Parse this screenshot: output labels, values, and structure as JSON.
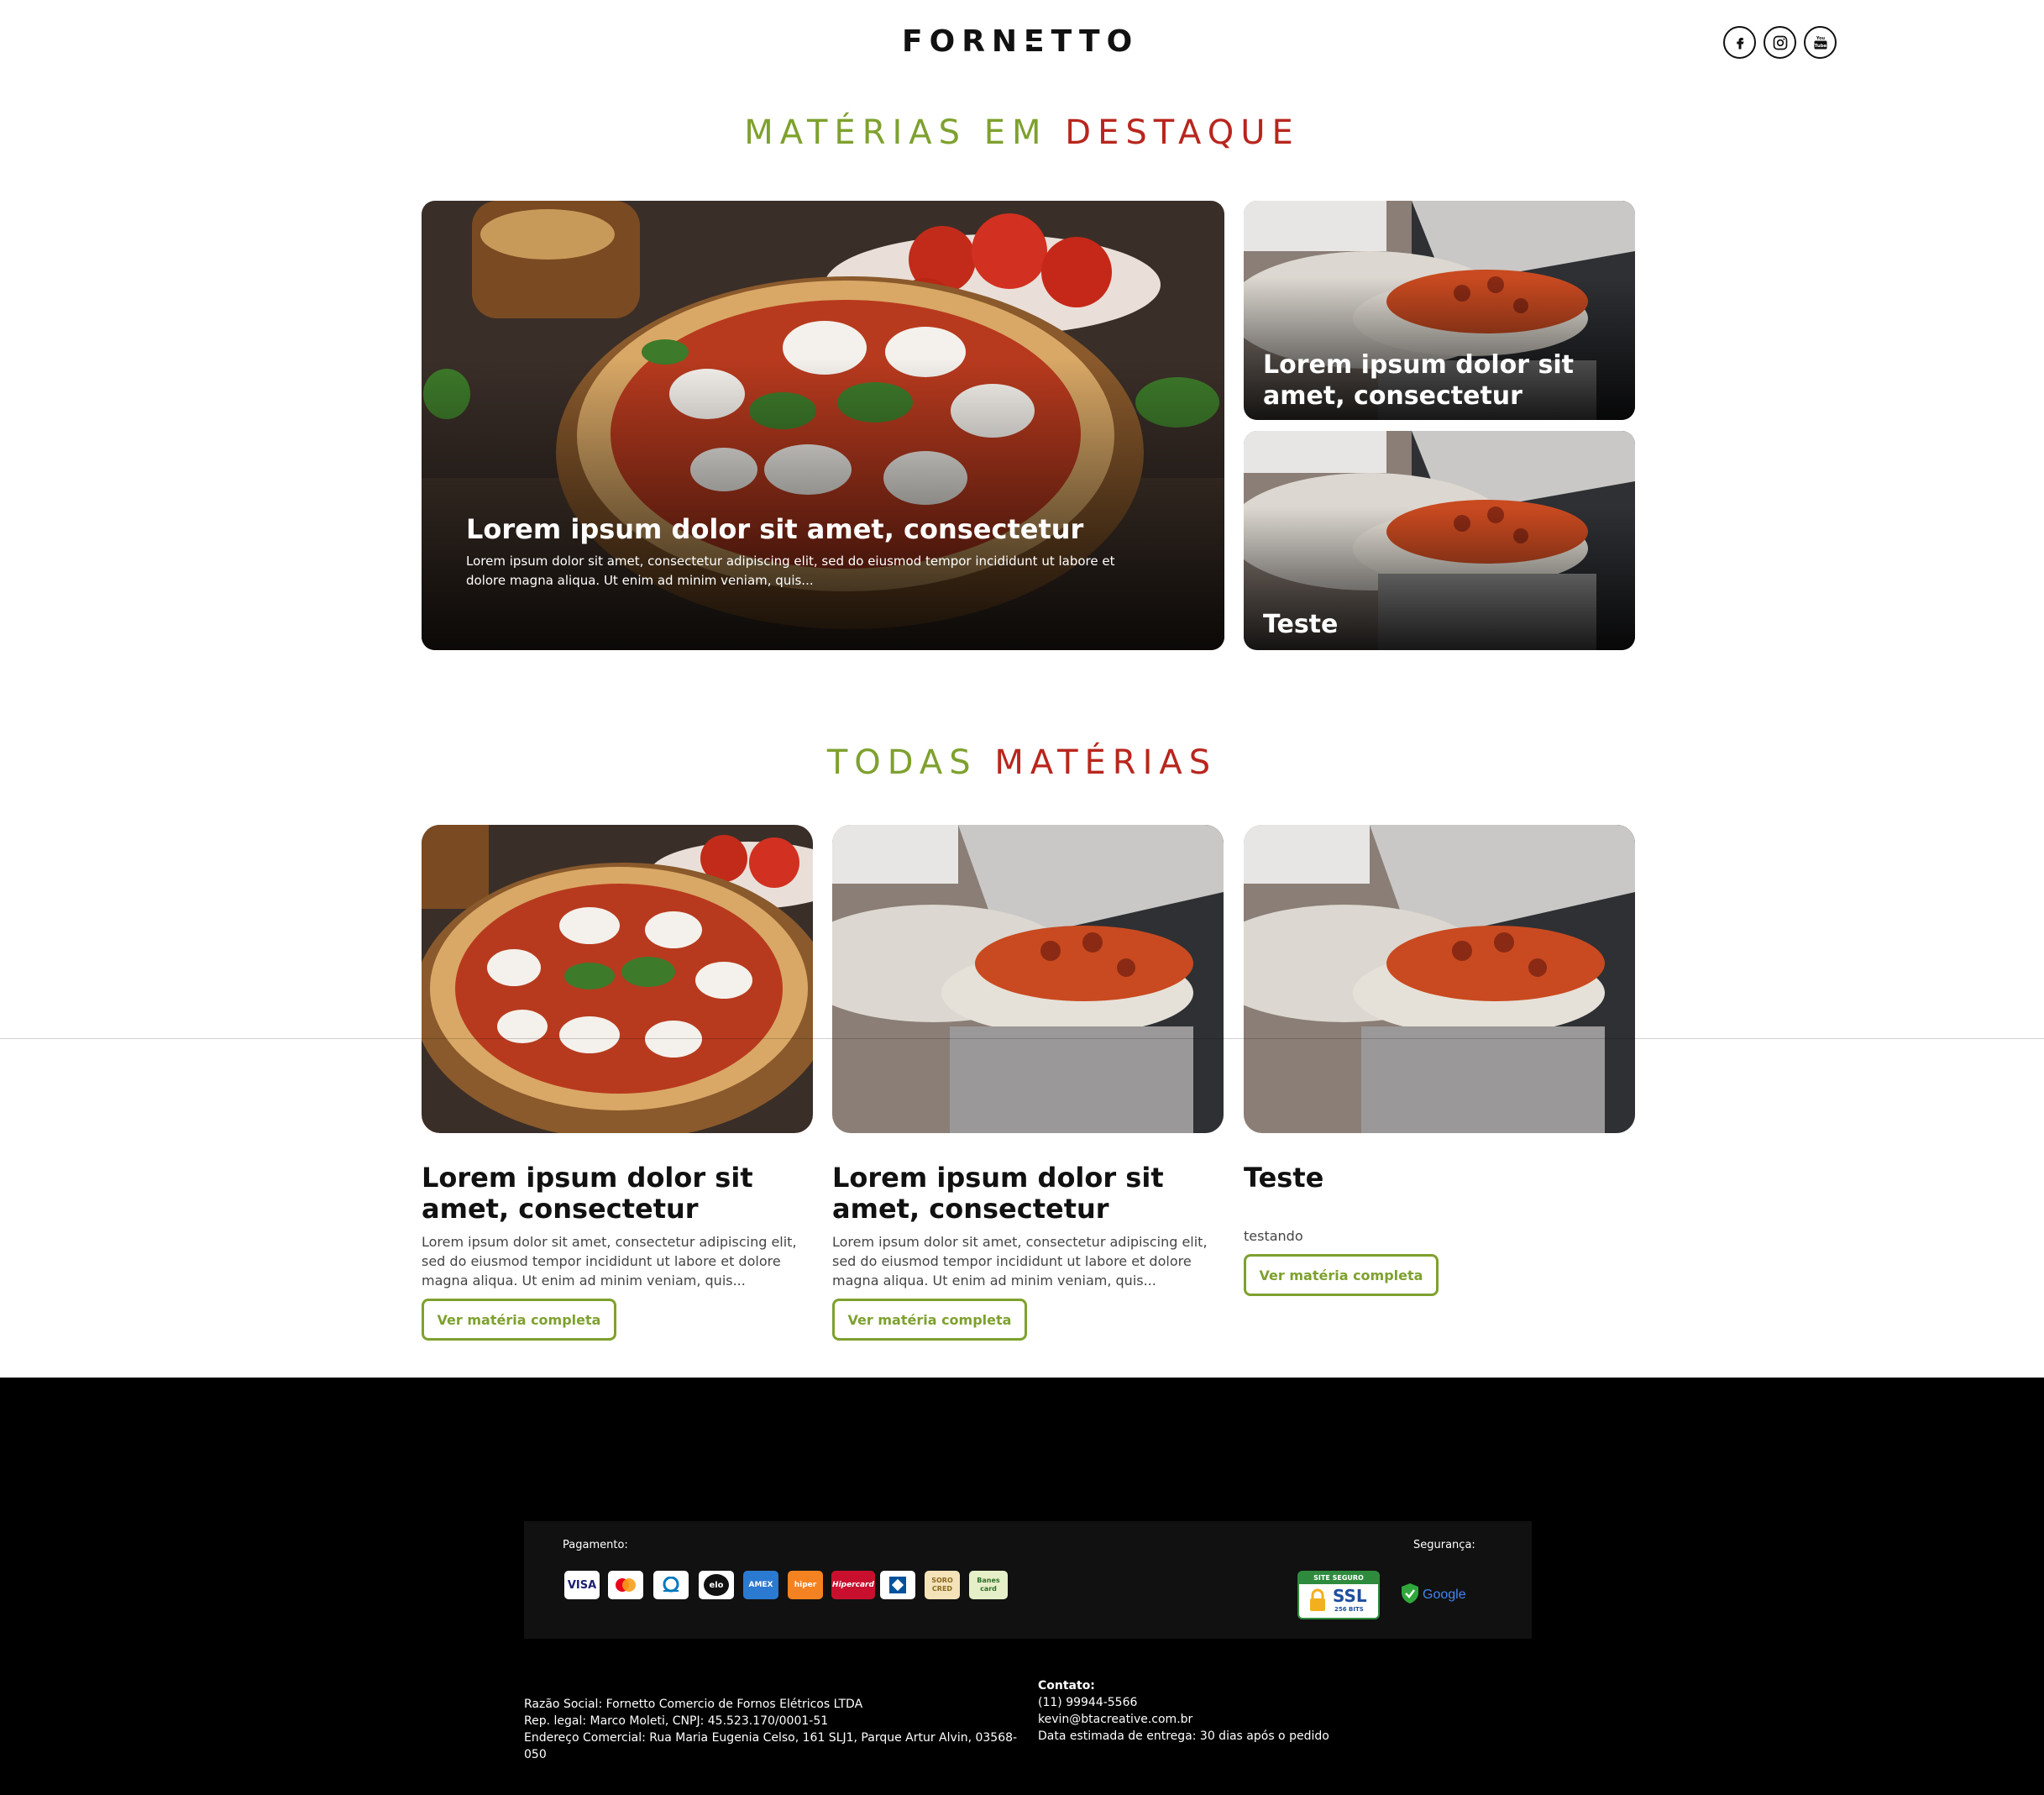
{
  "header": {
    "logo": "FORNETTO",
    "social": [
      "facebook-icon",
      "instagram-icon",
      "youtube-icon"
    ]
  },
  "featured": {
    "title_a": "MATÉRIAS EM",
    "title_b": "DESTAQUE",
    "main": {
      "title": "Lorem ipsum dolor sit amet, consectetur",
      "desc": "Lorem ipsum dolor sit amet, consectetur adipiscing elit, sed do eiusmod tempor incididunt ut labore et dolore magna aliqua. Ut enim ad minim veniam, quis..."
    },
    "side1": {
      "title": "Lorem ipsum dolor sit amet, consectetur"
    },
    "side2": {
      "title": "Teste"
    }
  },
  "all": {
    "title_a": "TODAS",
    "title_b": "MATÉRIAS",
    "articles": [
      {
        "title": "Lorem ipsum dolor sit amet, consectetur",
        "desc": "Lorem ipsum dolor sit amet, consectetur adipiscing elit, sed do eiusmod tempor incididunt ut labore et dolore magna aliqua. Ut enim ad minim veniam, quis...",
        "button": "Ver matéria completa"
      },
      {
        "title": "Lorem ipsum dolor sit amet, consectetur",
        "desc": "Lorem ipsum dolor sit amet, consectetur adipiscing elit, sed do eiusmod tempor incididunt ut labore et dolore magna aliqua. Ut enim ad minim veniam, quis...",
        "button": "Ver matéria completa"
      },
      {
        "title": "Teste",
        "desc": "testando",
        "button": "Ver matéria completa"
      }
    ]
  },
  "footer": {
    "payment_label": "Pagamento:",
    "security_label": "Segurança:",
    "payments": [
      "VISA",
      "",
      "",
      "elo",
      "AMEX",
      "hiper",
      "Hipercard",
      "",
      "SORO CRED",
      "Banes card"
    ],
    "ssl_top": "SITE SEGURO",
    "ssl_main": "SSL",
    "ssl_sub": "256 BITS",
    "google": "Google",
    "company": [
      "Razão Social: Fornetto Comercio de Fornos Elétricos LTDA",
      "Rep. legal: Marco Moleti, CNPJ: 45.523.170/0001-51",
      "Endereço Comercial: Rua Maria Eugenia Celso, 161 SLJ1, Parque Artur Alvin, 03568-050"
    ],
    "contact_label": "Contato:",
    "contact": [
      "(11) 99944-5566",
      "kevin@btacreative.com.br",
      "Data estimada de entrega: 30 dias após o pedido"
    ]
  },
  "colors": {
    "green": "#7ea12e",
    "red": "#b8261d"
  }
}
